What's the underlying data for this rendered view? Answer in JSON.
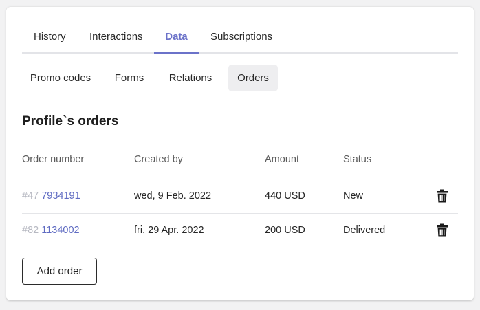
{
  "tabs": [
    {
      "label": "History"
    },
    {
      "label": "Interactions"
    },
    {
      "label": "Data",
      "active": true
    },
    {
      "label": "Subscriptions"
    }
  ],
  "subtabs": [
    {
      "label": "Promo codes"
    },
    {
      "label": "Forms"
    },
    {
      "label": "Relations"
    },
    {
      "label": "Orders",
      "active": true
    }
  ],
  "section_title": "Profile`s orders",
  "table": {
    "headers": [
      "Order number",
      "Created by",
      "Amount",
      "Status"
    ],
    "rows": [
      {
        "prefix": "#47",
        "number": "7934191",
        "created": "wed, 9 Feb. 2022",
        "amount": "440 USD",
        "status": "New"
      },
      {
        "prefix": "#82",
        "number": "1134002",
        "created": "fri, 29 Apr. 2022",
        "amount": "200 USD",
        "status": "Delivered"
      }
    ]
  },
  "add_button_label": "Add order",
  "colors": {
    "accent": "#6b72c9",
    "link": "#5f6bc2",
    "muted_prefix": "#b7b9c2"
  },
  "icons": {
    "delete": "trash-icon"
  }
}
